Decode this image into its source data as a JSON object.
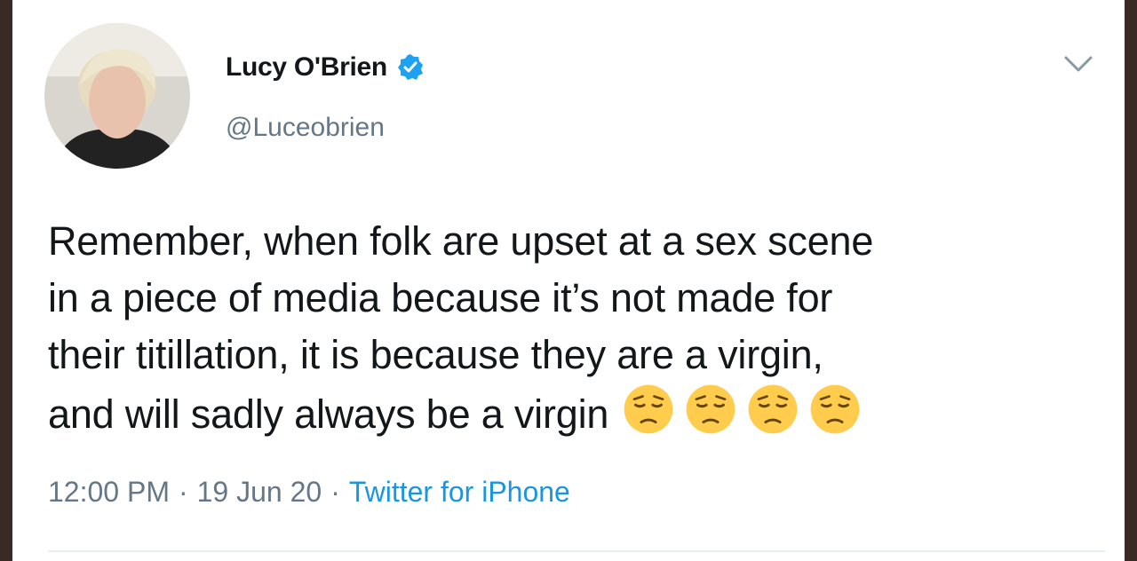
{
  "tweet": {
    "author": {
      "display_name": "Lucy O'Brien",
      "handle": "@Luceobrien",
      "verified": true,
      "avatar_icon": "profile-photo"
    },
    "text_lines": [
      "Remember, when folk are upset at a sex scene",
      "in a piece of media because it’s not made for",
      "their titillation, it is because they are a virgin,",
      "and will sadly always be a virgin"
    ],
    "trailing_emoji": [
      "pensive-face",
      "pensive-face",
      "pensive-face",
      "pensive-face"
    ],
    "meta": {
      "time": "12:00 PM",
      "separator": "·",
      "date": "19 Jun 20",
      "source": "Twitter for iPhone"
    }
  },
  "icons": {
    "verified": "verified-badge-icon",
    "more": "chevron-down-icon"
  },
  "colors": {
    "text": "#14171a",
    "secondary": "#657786",
    "link": "#1b95e0",
    "verified": "#1da1f2",
    "emoji": "#ffcc4d"
  }
}
